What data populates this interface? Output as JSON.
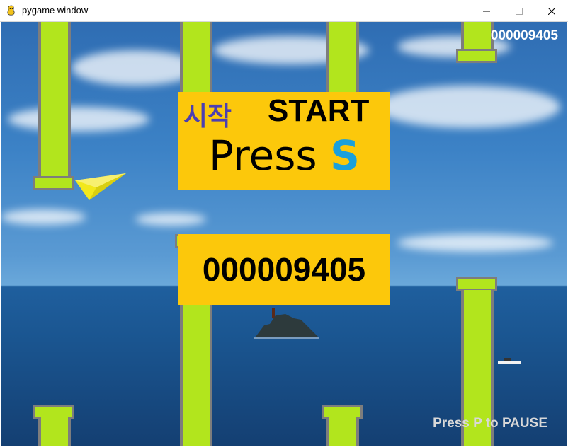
{
  "window": {
    "title": "pygame window",
    "app_icon": "pygame-snake-icon",
    "controls": [
      "minimize-icon",
      "maximize-icon",
      "close-icon"
    ]
  },
  "hud": {
    "score_top": "000009405",
    "pause_hint": "Press P to PAUSE"
  },
  "start_screen": {
    "korean_label": "시작",
    "start_label": "START",
    "press_label": "Press",
    "press_key": "S"
  },
  "score_panel": {
    "score": "000009405"
  },
  "colors": {
    "panel": "#fcc80b",
    "pipe": "#b2e51d",
    "pipe_border": "#7d7d7d",
    "korean_text": "#4b3fb2",
    "key_text": "#1aa0dc",
    "plane": "#f2e81c"
  },
  "player": {
    "icon": "paper-airplane-icon"
  }
}
